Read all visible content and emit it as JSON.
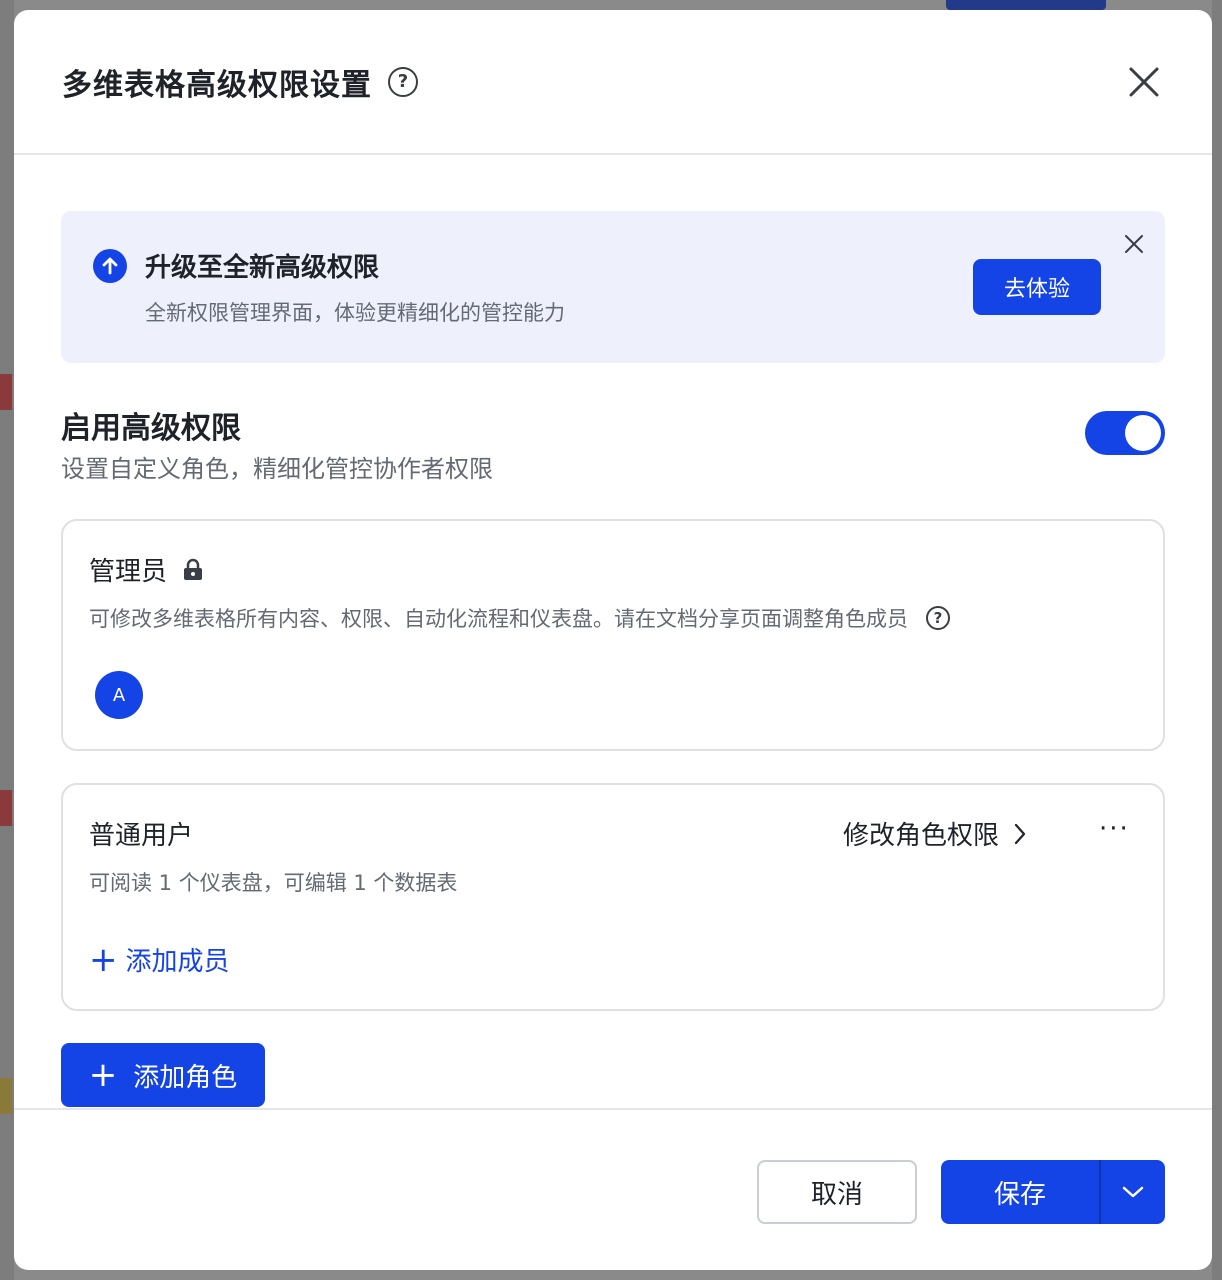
{
  "dialog": {
    "title": "多维表格高级权限设置"
  },
  "banner": {
    "title": "升级至全新高级权限",
    "description": "全新权限管理界面，体验更精细化的管控能力",
    "action_label": "去体验"
  },
  "advanced_permission": {
    "title": "启用高级权限",
    "description": "设置自定义角色，精细化管控协作者权限",
    "enabled": true
  },
  "roles": {
    "admin": {
      "name": "管理员",
      "description": "可修改多维表格所有内容、权限、自动化流程和仪表盘。请在文档分享页面调整角色成员",
      "avatar_initial": "A"
    },
    "user": {
      "name": "普通用户",
      "edit_label": "修改角色权限",
      "more_label": "···",
      "description": "可阅读 1 个仪表盘，可编辑 1 个数据表",
      "add_member_label": "添加成员"
    }
  },
  "actions": {
    "add_role_label": "添加角色",
    "cancel_label": "取消",
    "save_label": "保存"
  },
  "colors": {
    "accent": "#1443e6",
    "banner_bg": "#eef1fc"
  }
}
